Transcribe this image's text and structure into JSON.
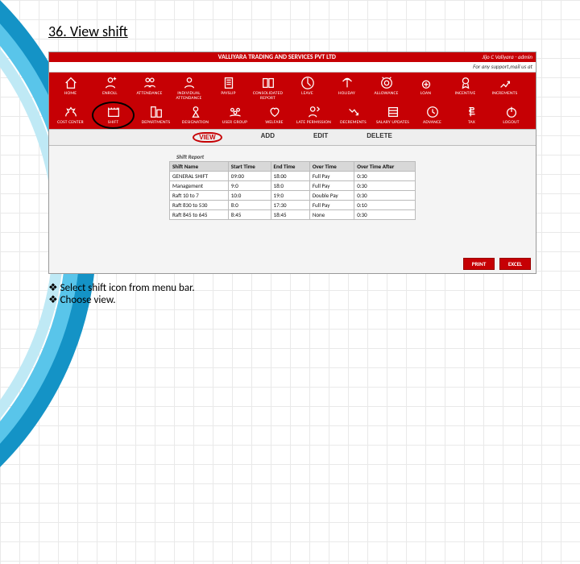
{
  "title": "36. View shift",
  "header": {
    "company": "VALLIYARA TRADING AND SERVICES PVT LTD",
    "user": "Jijo C Valiyara - admin",
    "support": "For any support,mail us at"
  },
  "icons": [
    {
      "id": "home",
      "label": "HOME"
    },
    {
      "id": "enroll",
      "label": "ENROLL"
    },
    {
      "id": "attendance",
      "label": "ATTENDANCE"
    },
    {
      "id": "indv-att",
      "label": "INDIVIDUAL ATTENDANCE"
    },
    {
      "id": "payslip",
      "label": "PAYSLIP"
    },
    {
      "id": "cons-report",
      "label": "CONSOLIDATED REPORT"
    },
    {
      "id": "leave",
      "label": "LEAVE"
    },
    {
      "id": "holiday",
      "label": "HOLIDAY"
    },
    {
      "id": "allowance",
      "label": "ALLOWANCE"
    },
    {
      "id": "loan",
      "label": "LOAN"
    },
    {
      "id": "incentive",
      "label": "INCENTIVE"
    },
    {
      "id": "increments",
      "label": "INCREMENTS"
    },
    {
      "id": "cost-center",
      "label": "COST CENTER"
    },
    {
      "id": "shift",
      "label": "SHIFT",
      "hl": true
    },
    {
      "id": "departments",
      "label": "DEPARTMENTS"
    },
    {
      "id": "designation",
      "label": "DESIGNATION"
    },
    {
      "id": "user-group",
      "label": "USER GROUP"
    },
    {
      "id": "welfare",
      "label": "WELFARE"
    },
    {
      "id": "late-perm",
      "label": "LATE PERMISSION"
    },
    {
      "id": "decrements",
      "label": "DECREMENTS"
    },
    {
      "id": "sal-update",
      "label": "SALARY UPDATES"
    },
    {
      "id": "advance",
      "label": "ADVANCE"
    },
    {
      "id": "tax",
      "label": "TAX"
    },
    {
      "id": "logout",
      "label": "LOGOUT"
    }
  ],
  "actions": {
    "view": "VIEW",
    "add": "ADD",
    "edit": "EDIT",
    "delete": "DELETE"
  },
  "report": {
    "title": "Shift Report",
    "headers": [
      "Shift Name",
      "Start Time",
      "End Time",
      "Over Time",
      "Over Time After"
    ],
    "rows": [
      [
        "GENERAL SHIFT",
        "09:00",
        "18:00",
        "Full Pay",
        "0:30"
      ],
      [
        "Management",
        "9:0",
        "18:0",
        "Full Pay",
        "0:30"
      ],
      [
        "Raft 10 to 7",
        "10:0",
        "19:0",
        "Double Pay",
        "0:30"
      ],
      [
        "Raft 830 to 530",
        "8:0",
        "17:30",
        "Full Pay",
        "0:10"
      ],
      [
        "Raft 845 to 645",
        "8:45",
        "18:45",
        "None",
        "0:30"
      ]
    ]
  },
  "buttons": {
    "print": "PRINT",
    "excel": "EXCEL"
  },
  "bullets": [
    "Select shift icon from menu bar.",
    "Choose view."
  ]
}
